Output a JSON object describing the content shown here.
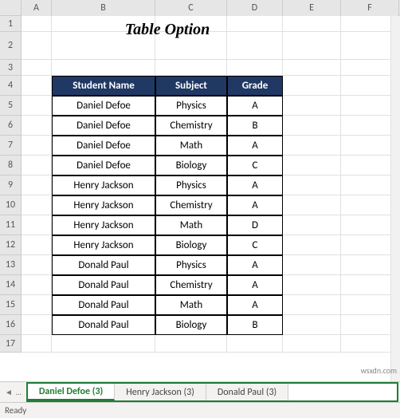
{
  "title": "Table Option",
  "columns": [
    "A",
    "B",
    "C",
    "D",
    "E",
    "F"
  ],
  "rows": [
    "1",
    "2",
    "3",
    "4",
    "5",
    "6",
    "7",
    "8",
    "9",
    "10",
    "11",
    "12",
    "13",
    "14",
    "15",
    "16",
    "17"
  ],
  "table": {
    "headers": {
      "student": "Student Name",
      "subject": "Subject",
      "grade": "Grade"
    },
    "data": [
      {
        "student": "Daniel Defoe",
        "subject": "Physics",
        "grade": "A"
      },
      {
        "student": "Daniel Defoe",
        "subject": "Chemistry",
        "grade": "B"
      },
      {
        "student": "Daniel Defoe",
        "subject": "Math",
        "grade": "A"
      },
      {
        "student": "Daniel Defoe",
        "subject": "Biology",
        "grade": "C"
      },
      {
        "student": "Henry Jackson",
        "subject": "Physics",
        "grade": "A"
      },
      {
        "student": "Henry Jackson",
        "subject": "Chemistry",
        "grade": "A"
      },
      {
        "student": "Henry Jackson",
        "subject": "Math",
        "grade": "D"
      },
      {
        "student": "Henry Jackson",
        "subject": "Biology",
        "grade": "C"
      },
      {
        "student": "Donald Paul",
        "subject": "Physics",
        "grade": "A"
      },
      {
        "student": "Donald Paul",
        "subject": "Chemistry",
        "grade": "A"
      },
      {
        "student": "Donald Paul",
        "subject": "Math",
        "grade": "A"
      },
      {
        "student": "Donald Paul",
        "subject": "Biology",
        "grade": "B"
      }
    ]
  },
  "tabs": [
    {
      "label": "Daniel Defoe (3)",
      "active": true
    },
    {
      "label": "Henry Jackson (3)",
      "active": false
    },
    {
      "label": "Donald Paul (3)",
      "active": false
    }
  ],
  "status": "Ready",
  "watermark": "wsxdn.com",
  "nav": {
    "prev": "◄",
    "first": "…",
    "next": "▶"
  }
}
